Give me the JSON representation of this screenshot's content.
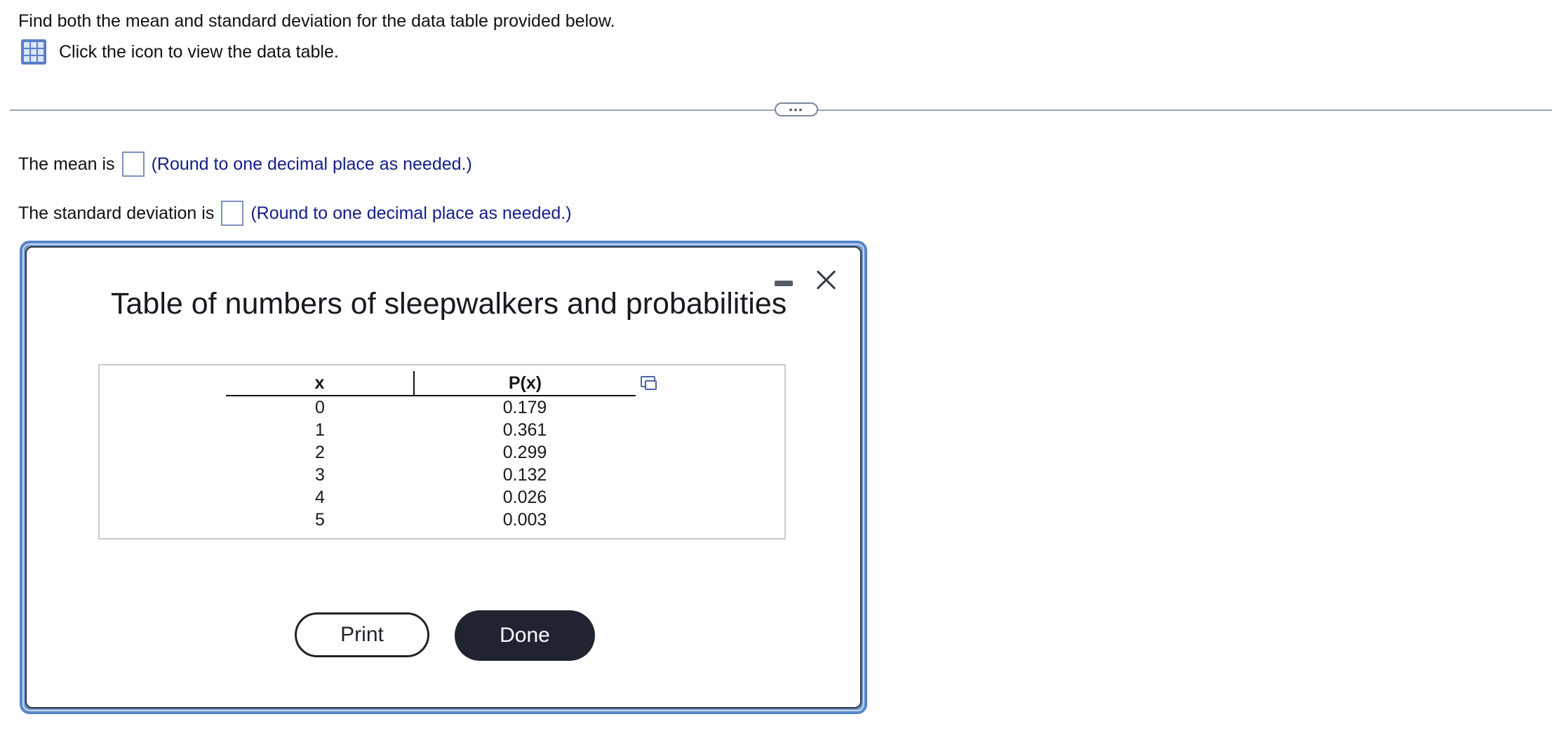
{
  "question": {
    "prompt": "Find both the mean and standard deviation for the data table provided below.",
    "data_link_label": "Click the icon to view the data table."
  },
  "answers": {
    "mean_label": "The mean is",
    "mean_value": "",
    "mean_hint": "(Round to one decimal place as needed.)",
    "sd_label": "The standard deviation is",
    "sd_value": "",
    "sd_hint": "(Round to one decimal place as needed.)"
  },
  "divider": {
    "more_label": "•••"
  },
  "dialog": {
    "title": "Table of numbers of sleepwalkers and probabilities",
    "table": {
      "headers": [
        "x",
        "P(x)"
      ],
      "rows": [
        [
          "0",
          "0.179"
        ],
        [
          "1",
          "0.361"
        ],
        [
          "2",
          "0.299"
        ],
        [
          "3",
          "0.132"
        ],
        [
          "4",
          "0.026"
        ],
        [
          "5",
          "0.003"
        ]
      ]
    },
    "print_label": "Print",
    "done_label": "Done"
  },
  "icons": {
    "data_table": "table-icon",
    "minimize": "minimize-icon",
    "close": "close-icon",
    "copy": "copy-icon"
  },
  "colors": {
    "hint_text": "#121f88",
    "dialog_border": "#5686c7",
    "done_button": "#1f2430"
  }
}
